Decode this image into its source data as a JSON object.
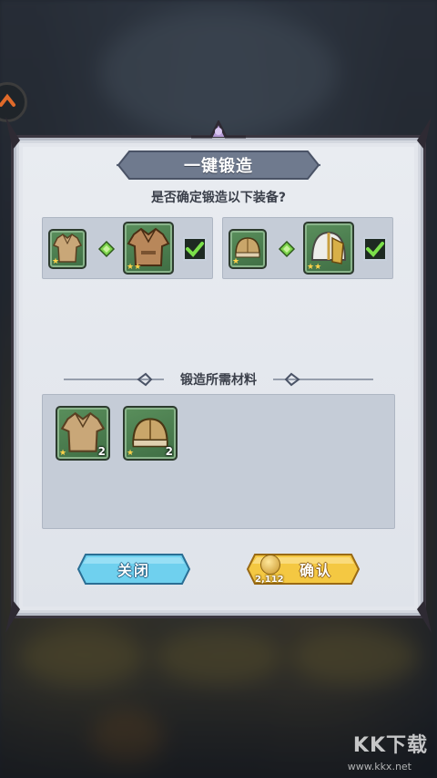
{
  "dialog": {
    "title": "一键锻造",
    "question": "是否确定锻造以下装备?",
    "forge_pairs": [
      {
        "from_icon": "light-armor-icon",
        "to_icon": "leather-armor-icon",
        "checked": true
      },
      {
        "from_icon": "bronze-helmet-icon",
        "to_icon": "silver-helmet-icon",
        "checked": true
      }
    ],
    "materials_title": "锻造所需材料",
    "materials": [
      {
        "icon": "light-armor-icon",
        "count": "2"
      },
      {
        "icon": "bronze-helmet-icon",
        "count": "2"
      }
    ],
    "close_label": "关闭",
    "confirm_label": "确认",
    "cost": "2,112"
  },
  "watermark": {
    "logo": "KK下载",
    "url": "www.kkx.net"
  },
  "colors": {
    "slot_green": "#4a7d4f",
    "close_blue": "#5ec6e8",
    "confirm_gold": "#f0c040",
    "panel": "#c5ccd7"
  }
}
